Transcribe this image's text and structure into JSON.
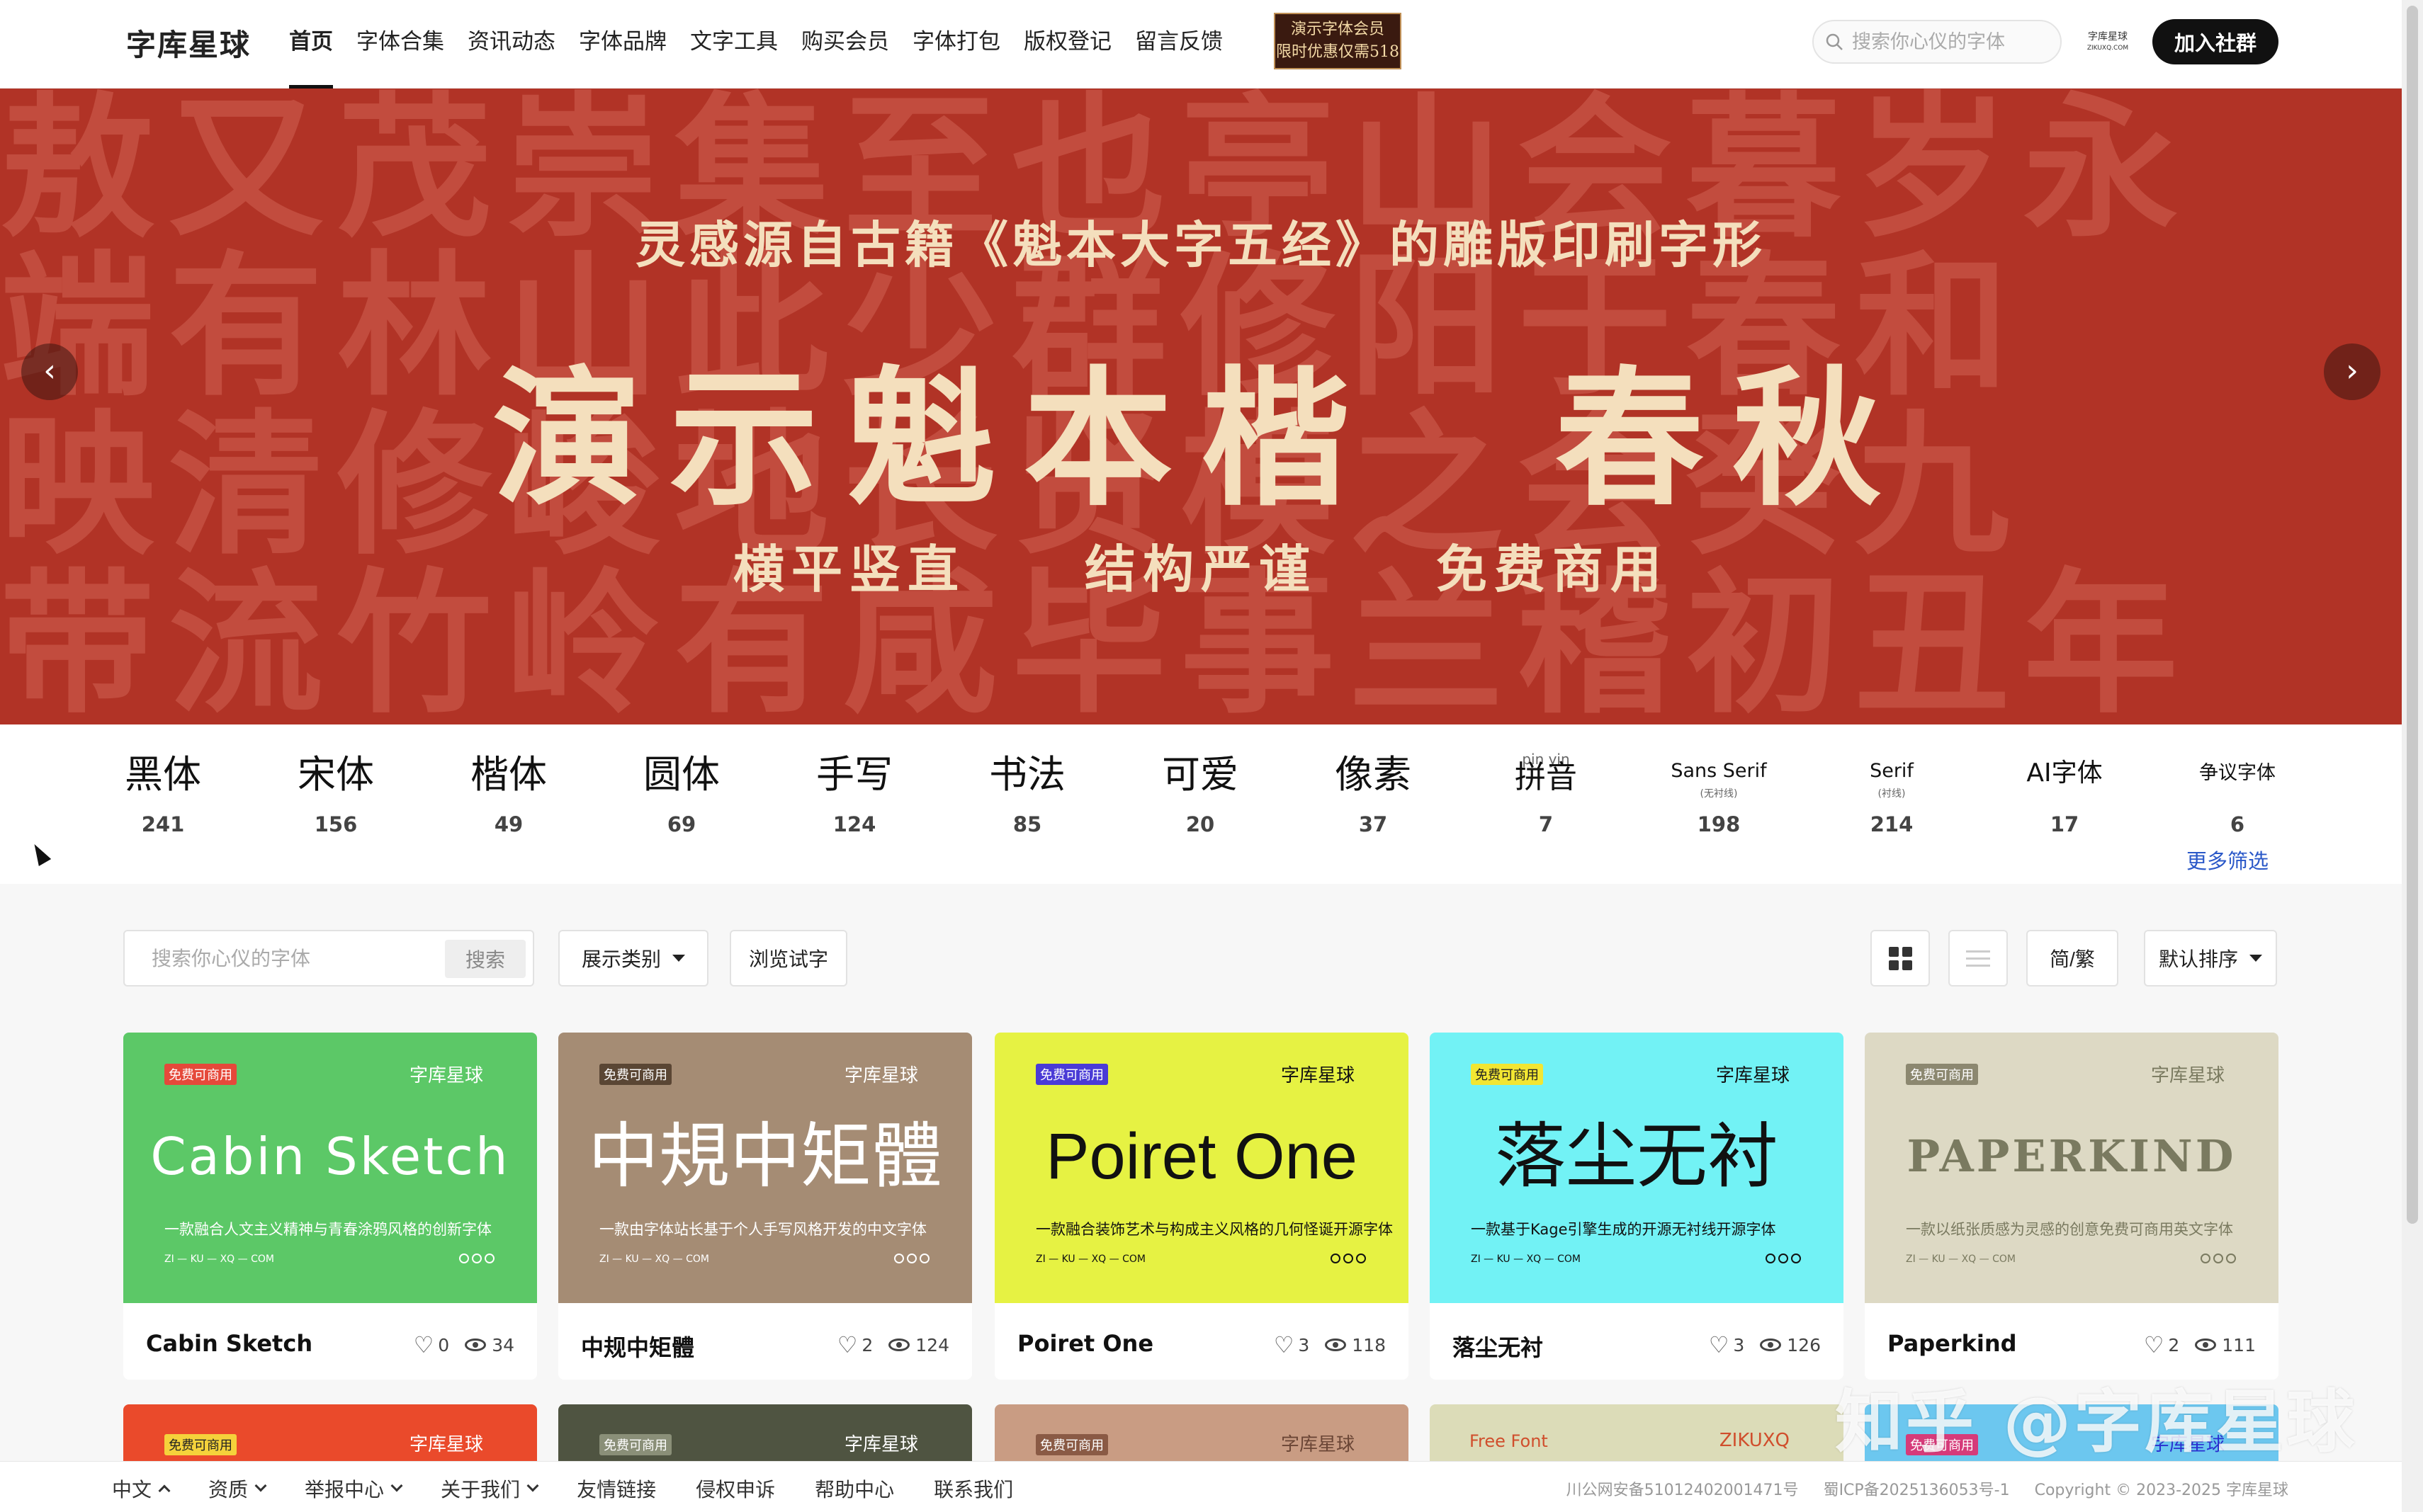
{
  "header": {
    "logo": "字库星球",
    "nav": [
      "首页",
      "字体合集",
      "资讯动态",
      "字体品牌",
      "文字工具",
      "购买会员",
      "字体打包",
      "版权登记",
      "留言反馈"
    ],
    "promo_line1": "演示字体会员",
    "promo_line2": "限时优惠仅需518",
    "search_placeholder": "搜索你心仪的字体",
    "mini_brand_line1": "字库星球",
    "mini_brand_line2": "ZIKUXQ.COM",
    "join_label": "加入社群"
  },
  "banner": {
    "bg_rows": [
      "敖又茂崇集至也亭山会暮岁永",
      "端有林山此少群修阳于春和",
      "映清修峻地长贤模之会癸九",
      "带流竹岭有咸毕事兰稽初丑年"
    ],
    "subtitle": "灵感源自古籍《魁本大字五经》的雕版印刷字形",
    "title": "演示魁本楷　春秋",
    "tags": [
      "横平竖直",
      "结构严谨",
      "免费商用"
    ],
    "prev_icon": "‹",
    "next_icon": "›"
  },
  "categories": [
    {
      "name": "黑体",
      "count": "241"
    },
    {
      "name": "宋体",
      "count": "156"
    },
    {
      "name": "楷体",
      "count": "49"
    },
    {
      "name": "圆体",
      "count": "69"
    },
    {
      "name": "手写",
      "count": "124"
    },
    {
      "name": "书法",
      "count": "85"
    },
    {
      "name": "可爱",
      "count": "20"
    },
    {
      "name": "像素",
      "count": "37"
    },
    {
      "name": "拼音",
      "count": "7",
      "pinyin": "pin  yin"
    },
    {
      "name": "Sans Serif",
      "count": "198",
      "sub": "(无衬线)"
    },
    {
      "name": "Serif",
      "count": "214",
      "sub": "(衬线)"
    },
    {
      "name": "AI字体",
      "count": "17"
    },
    {
      "name": "争议字体",
      "count": "6"
    }
  ],
  "more_filter": "更多筛选",
  "toolbar": {
    "search_placeholder": "搜索你心仪的字体",
    "search_button": "搜索",
    "category_select": "展示类别",
    "browse_label": "浏览试字",
    "simp_trad": "简/繁",
    "sort_select": "默认排序"
  },
  "cards": [
    {
      "badge": "免费可商用",
      "brand": "字库星球",
      "display": "Cabin Sketch",
      "desc": "一款融合人文主义精神与青春涂鸦风格的创新字体",
      "site": "ZI — KU — XQ — COM",
      "name": "Cabin Sketch",
      "likes": "0",
      "views": "34",
      "bg": "#5cc867",
      "fg": "#ffffff",
      "badge_bg": "#e5493a"
    },
    {
      "badge": "免费可商用",
      "brand": "字库星球",
      "display": "中規中矩體",
      "desc": "一款由字体站长基于个人手写风格开发的中文字体",
      "site": "ZI — KU — XQ — COM",
      "name": "中规中矩體",
      "likes": "2",
      "views": "124",
      "bg": "#a58c74",
      "fg": "#ffffff",
      "badge_bg": "#5a4634"
    },
    {
      "badge": "免费可商用",
      "brand": "字库星球",
      "display": "Poiret One",
      "desc": "一款融合装饰艺术与构成主义风格的几何怪诞开源字体",
      "site": "ZI — KU — XQ — COM",
      "name": "Poiret One",
      "likes": "3",
      "views": "118",
      "bg": "#e6f243",
      "fg": "#111111",
      "badge_bg": "#4a3bd6"
    },
    {
      "badge": "免费可商用",
      "brand": "字库星球",
      "display": "落尘无衬",
      "desc": "一款基于Kage引擎生成的开源无衬线开源字体",
      "site": "ZI — KU — XQ — COM",
      "name": "落尘无衬",
      "likes": "3",
      "views": "126",
      "bg": "#72f2f5",
      "fg": "#111111",
      "badge_bg": "#f2e632"
    },
    {
      "badge": "免费可商用",
      "brand": "字库星球",
      "display": "PAPERKIND",
      "desc": "一款以纸张质感为灵感的创意免费可商用英文字体",
      "site": "ZI — KU — XQ — COM",
      "name": "Paperkind",
      "likes": "2",
      "views": "111",
      "bg": "#ddd9c4",
      "fg": "#7a7a60",
      "badge_bg": "#8c8870"
    }
  ],
  "cards_row2": [
    {
      "badge": "免费可商用",
      "brand": "字库星球",
      "bg": "#ea4a2b",
      "fg": "#ffffff",
      "badge_bg": "#f5d23b"
    },
    {
      "badge": "免费可商用",
      "brand": "字库星球",
      "bg": "#4f5441",
      "fg": "#ffffff",
      "badge_bg": "#8a8f78"
    },
    {
      "badge": "免费可商用",
      "brand": "字库星球",
      "bg": "#c99c83",
      "fg": "#6b4636",
      "badge_bg": "#8a5a45"
    },
    {
      "badge": "Free Font",
      "brand": "ZIKUXQ",
      "bg": "#dcdcb8",
      "fg": "#d04e2c",
      "badge_bg": "transparent"
    },
    {
      "badge": "免费可商用",
      "brand": "字库星球",
      "bg": "#6cc7ef",
      "fg": "#2a2fd0",
      "badge_bg": "#d63b7a"
    }
  ],
  "footer": {
    "items": [
      {
        "label": "中文",
        "chevron": "up"
      },
      {
        "label": "资质",
        "chevron": "down"
      },
      {
        "label": "举报中心",
        "chevron": "down"
      },
      {
        "label": "关于我们",
        "chevron": "down"
      },
      {
        "label": "友情链接"
      },
      {
        "label": "侵权申诉"
      },
      {
        "label": "帮助中心"
      },
      {
        "label": "联系我们"
      }
    ],
    "police_record": "川公网安备51012402001471号",
    "icp": "蜀ICP备2025136053号-1",
    "copyright": "Copyright © 2023-2025 字库星球"
  },
  "watermark": "知乎 @字库星球"
}
